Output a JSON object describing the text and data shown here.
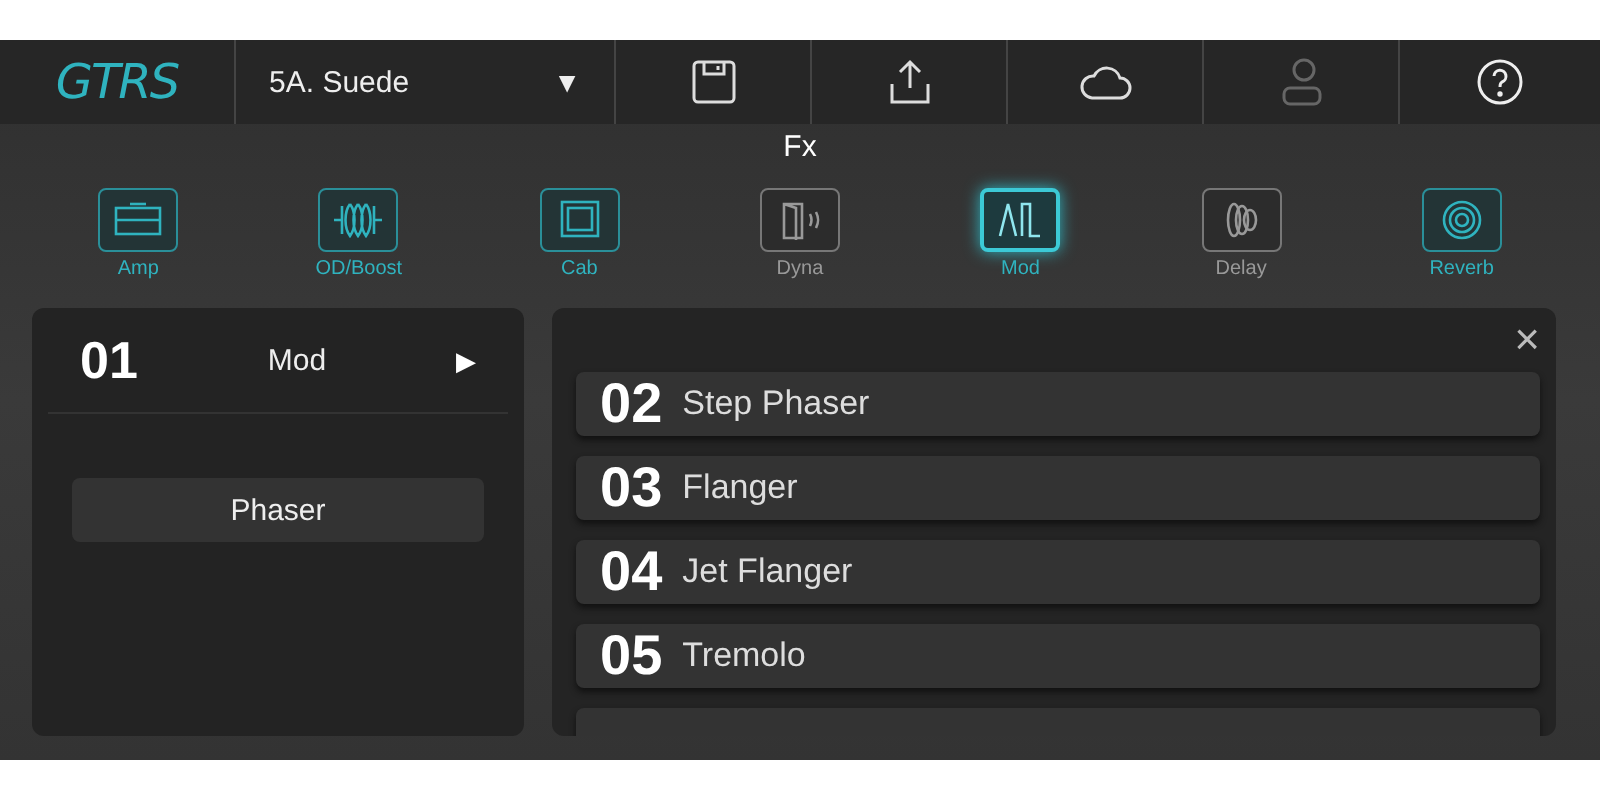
{
  "top_bar": {
    "logo": "GTRS",
    "preset": "5A. Suede",
    "preset_caret": "▼"
  },
  "section_title": "Fx",
  "effects": [
    {
      "label": "Amp",
      "kind": "amp",
      "on": true,
      "selected": false
    },
    {
      "label": "OD/Boost",
      "kind": "boost",
      "on": true,
      "selected": false
    },
    {
      "label": "Cab",
      "kind": "cab",
      "on": true,
      "selected": false
    },
    {
      "label": "Dyna",
      "kind": "dyna",
      "on": false,
      "selected": false
    },
    {
      "label": "Mod",
      "kind": "mod",
      "on": true,
      "selected": true
    },
    {
      "label": "Delay",
      "kind": "delay",
      "on": false,
      "selected": false
    },
    {
      "label": "Reverb",
      "kind": "reverb",
      "on": true,
      "selected": false
    }
  ],
  "slot_panel": {
    "number": "01",
    "category": "Mod",
    "play": "▶",
    "current": "Phaser"
  },
  "model_list": {
    "close": "×",
    "items": [
      {
        "number": "02",
        "name": "Step Phaser"
      },
      {
        "number": "03",
        "name": "Flanger"
      },
      {
        "number": "04",
        "name": "Jet Flanger"
      },
      {
        "number": "05",
        "name": "Tremolo"
      }
    ]
  }
}
